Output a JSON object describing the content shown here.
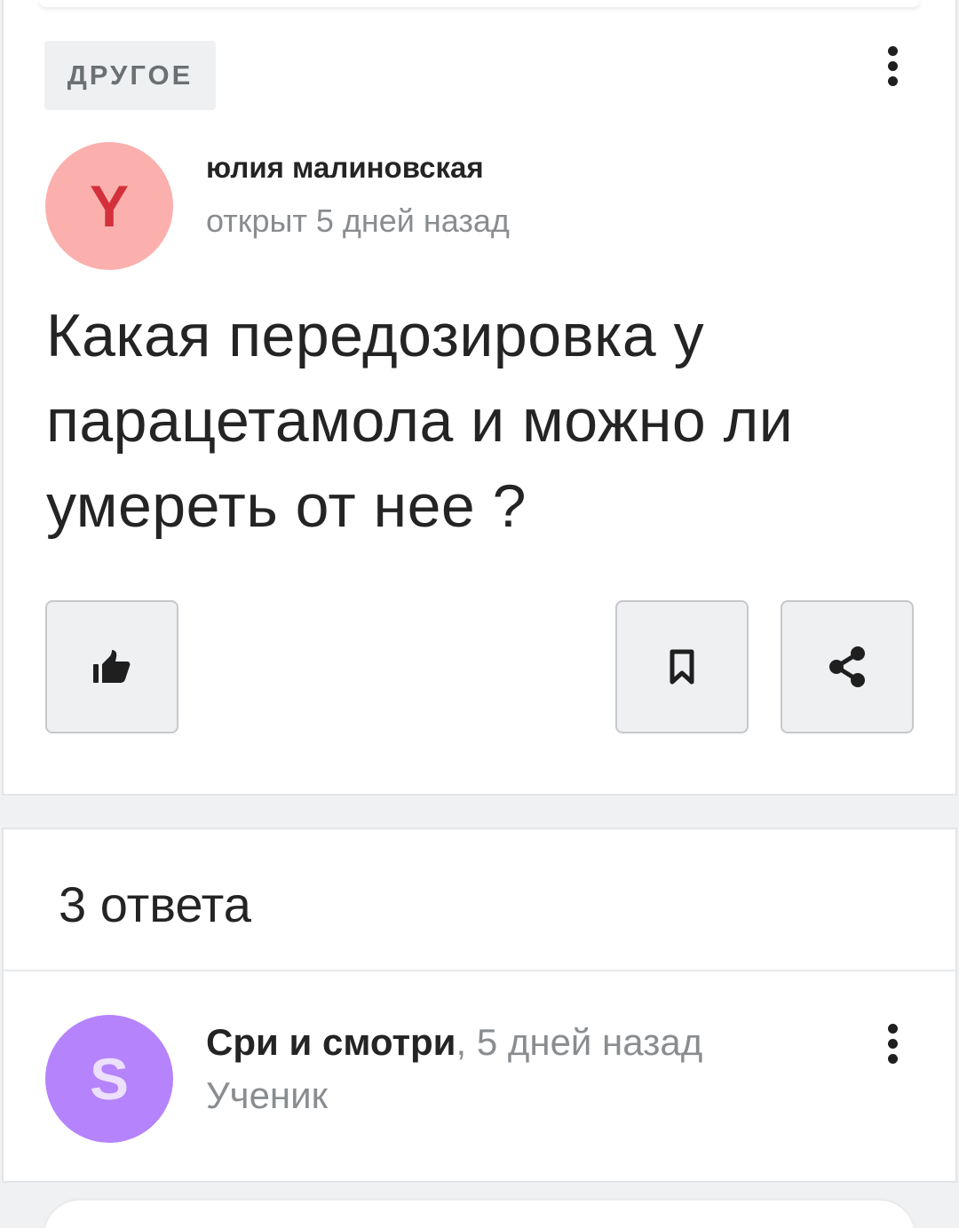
{
  "question": {
    "category": "ДРУГОЕ",
    "author": {
      "initial": "Y",
      "name": "юлия малиновская",
      "meta": "открыт 5 дней назад",
      "avatar_bg": "#fbb0ae",
      "avatar_fg": "#d3303b"
    },
    "text": "Какая передозировка у парацетамола и можно ли умереть от нее ?",
    "actions": {
      "like_icon": "thumbs-up-icon",
      "bookmark_icon": "bookmark-icon",
      "share_icon": "share-icon"
    }
  },
  "answers": {
    "count_label": "3 ответа",
    "items": [
      {
        "initial": "S",
        "name": "Сри и смотри",
        "separator": ",",
        "time": "5 дней назад",
        "role": "Ученик",
        "avatar_bg": "#b583fb",
        "avatar_fg": "#ece0fe"
      }
    ]
  },
  "colors": {
    "background": "#f0f1f3",
    "card": "#ffffff",
    "text": "#242424",
    "muted": "#8a8d90",
    "button_bg": "#eff0f2"
  }
}
